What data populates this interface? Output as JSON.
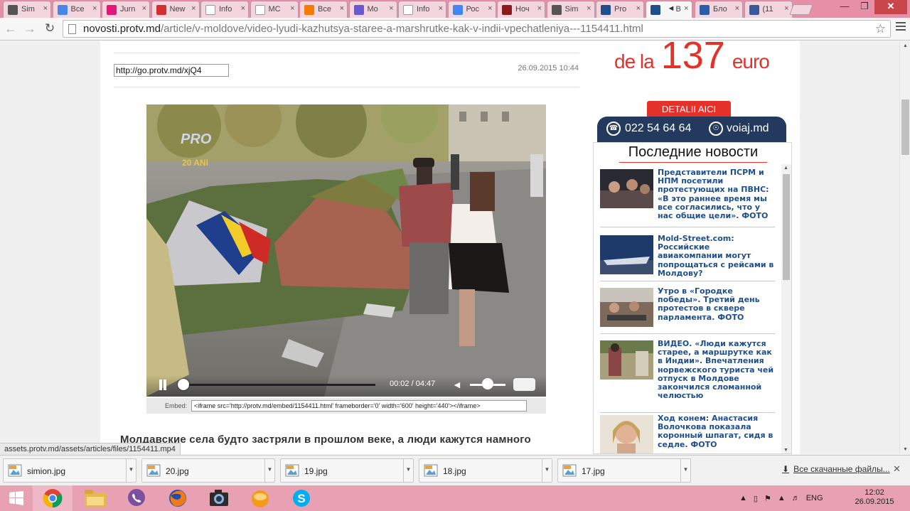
{
  "browser": {
    "tabs": [
      {
        "label": "Sim",
        "icon": "flask-icon",
        "color": "#555555"
      },
      {
        "label": "Все",
        "icon": "grid-icon",
        "color": "#4a86e8"
      },
      {
        "label": "Jurn",
        "icon": "t-icon",
        "color": "#e0197b"
      },
      {
        "label": "New",
        "icon": "news-icon",
        "color": "#d32f2f"
      },
      {
        "label": "Info",
        "icon": "page-icon",
        "color": "#ffffff"
      },
      {
        "label": "МС",
        "icon": "page-icon",
        "color": "#ffffff"
      },
      {
        "label": "Все",
        "icon": "plane-icon",
        "color": "#f57c00"
      },
      {
        "label": "Mo",
        "icon": "m-icon",
        "color": "#6a5acd"
      },
      {
        "label": "Info",
        "icon": "page-icon",
        "color": "#ffffff"
      },
      {
        "label": "Рос",
        "icon": "google-icon",
        "color": "#4285f4"
      },
      {
        "label": "Ноч",
        "icon": "crest-icon",
        "color": "#8b1a1a"
      },
      {
        "label": "Sim",
        "icon": "flask-icon",
        "color": "#555555"
      },
      {
        "label": "Pro",
        "icon": "protv-icon",
        "color": "#1e4f8c"
      },
      {
        "label": "В",
        "icon": "protv-icon",
        "color": "#1e4f8c",
        "active": true,
        "audio": true
      },
      {
        "label": "Бло",
        "icon": "b-icon",
        "color": "#2a5ea8"
      },
      {
        "label": "(11",
        "icon": "facebook-icon",
        "color": "#3b5998"
      }
    ],
    "url_host": "novosti.protv.md",
    "url_path": "/article/v-moldove/video-lyudi-kazhutsya-staree-a-marshrutke-kak-v-indii-vpechatleniya---1154411.html"
  },
  "article": {
    "short_url": "http://go.protv.md/xjQ4",
    "date": "26.09.2015 10:44",
    "video": {
      "time_current": "00:02",
      "time_total": "04:47",
      "progress": 0.007,
      "volume": 0.5,
      "logo_text": "PRO",
      "logo_sub": "20 ANI"
    },
    "embed_label": "Embed:",
    "embed_code": "<iframe src='http://protv.md/embed/1154411.html' frameborder='0' width='600' height='440'></iframe>",
    "body_start": "Молдавские села будто застряли в прошлом веке, а люди кажутся намного"
  },
  "ad": {
    "price_prefix": "de la",
    "price_value": "137",
    "price_suffix": "euro",
    "cta": "DETALII AICI",
    "phone": "022 54 64 64",
    "site": "voiaj.md",
    "accent": "#e4322b",
    "bar_color": "#23395e"
  },
  "news": {
    "title": "Последние новости",
    "items": [
      {
        "text": "Представители ПСРМ и НПМ посетили протестующих на ПВНС: «В это раннее время мы все согласились, что у нас общие цели». ФОТО"
      },
      {
        "text": "Mold-Street.com: Российские авиакомпании могут попрощаться с рейсами в Молдову?"
      },
      {
        "text": "Утро в «Городке победы». Третий день протестов в сквере парламента. ФОТО"
      },
      {
        "text": "ВИДЕО. «Люди кажутся старее, а маршрутке как в Индии». Впечатления норвежского туриста чей отпуск в Молдове закончился сломанной челюстью"
      },
      {
        "text": "Ход конем: Анастасия Волочкова показала коронный шпагат, сидя в седле. ФОТО"
      }
    ]
  },
  "status_url": "assets.protv.md/assets/articles/files/1154411.mp4",
  "downloads": {
    "files": [
      "simion.jpg",
      "20.jpg",
      "19.jpg",
      "18.jpg",
      "17.jpg"
    ],
    "show_all": "Все скачанные файлы..."
  },
  "taskbar": {
    "apps": [
      "start-icon",
      "chrome-icon",
      "explorer-icon",
      "viber-icon",
      "firefox-icon",
      "camera-icon",
      "orange-icon",
      "skype-icon"
    ],
    "lang": "ENG",
    "time": "12:02",
    "date": "26.09.2015"
  }
}
